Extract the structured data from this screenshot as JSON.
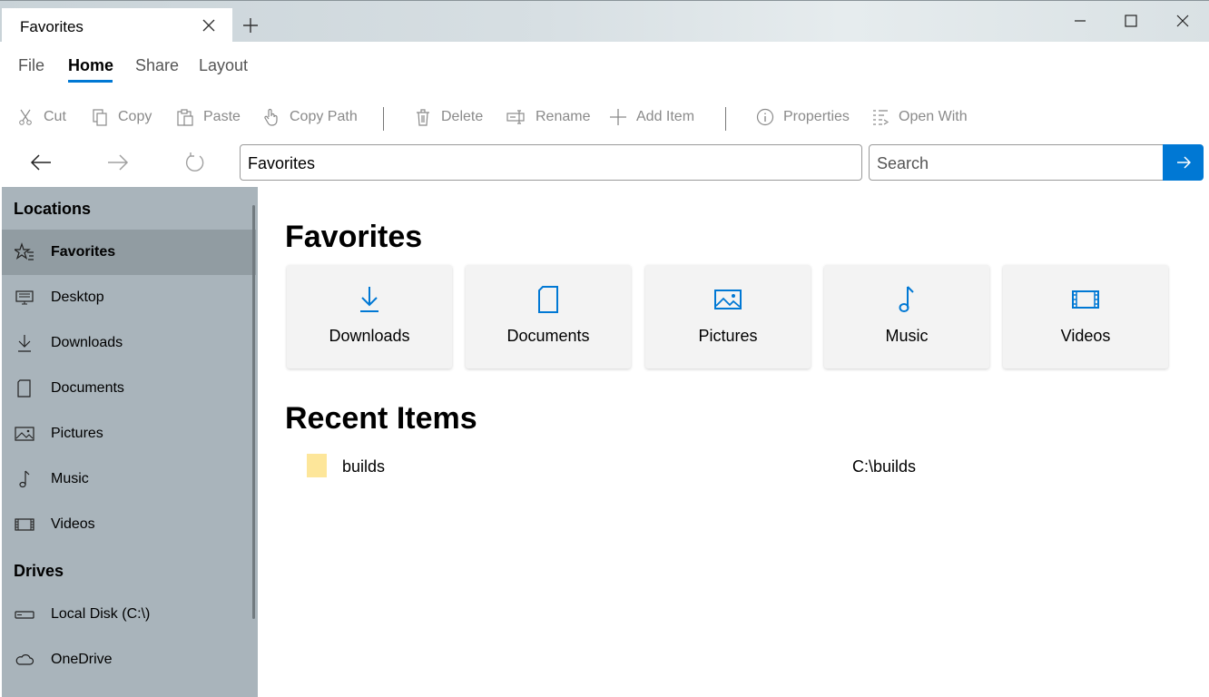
{
  "tab": {
    "title": "Favorites"
  },
  "ribbon": {
    "tabs": [
      "File",
      "Home",
      "Share",
      "Layout"
    ],
    "active": "Home"
  },
  "commands": {
    "cut": "Cut",
    "copy": "Copy",
    "paste": "Paste",
    "copy_path": "Copy Path",
    "delete": "Delete",
    "rename": "Rename",
    "add_item": "Add Item",
    "properties": "Properties",
    "open_with": "Open With"
  },
  "nav": {
    "address": "Favorites",
    "search_placeholder": "Search"
  },
  "sidebar": {
    "locations_header": "Locations",
    "locations": [
      {
        "label": "Favorites",
        "icon": "star-icon",
        "selected": true
      },
      {
        "label": "Desktop",
        "icon": "desktop-icon"
      },
      {
        "label": "Downloads",
        "icon": "download-icon"
      },
      {
        "label": "Documents",
        "icon": "document-icon"
      },
      {
        "label": "Pictures",
        "icon": "picture-icon"
      },
      {
        "label": "Music",
        "icon": "music-note-icon"
      },
      {
        "label": "Videos",
        "icon": "video-icon"
      }
    ],
    "drives_header": "Drives",
    "drives": [
      {
        "label": "Local Disk (C:\\)",
        "icon": "drive-icon"
      },
      {
        "label": "OneDrive",
        "icon": "cloud-icon"
      }
    ]
  },
  "main": {
    "favorites_title": "Favorites",
    "favorites": [
      {
        "label": "Downloads",
        "icon": "download-icon"
      },
      {
        "label": "Documents",
        "icon": "document-icon"
      },
      {
        "label": "Pictures",
        "icon": "picture-icon"
      },
      {
        "label": "Music",
        "icon": "music-note-icon"
      },
      {
        "label": "Videos",
        "icon": "video-icon"
      }
    ],
    "recent_title": "Recent Items",
    "recent": [
      {
        "name": "builds",
        "path": "C:\\builds",
        "icon": "folder-icon"
      }
    ]
  },
  "colors": {
    "accent": "#0078d4",
    "sidebar": "#a9b4bb",
    "sidebar_selected": "#919ca2",
    "folder": "#fde69a"
  }
}
